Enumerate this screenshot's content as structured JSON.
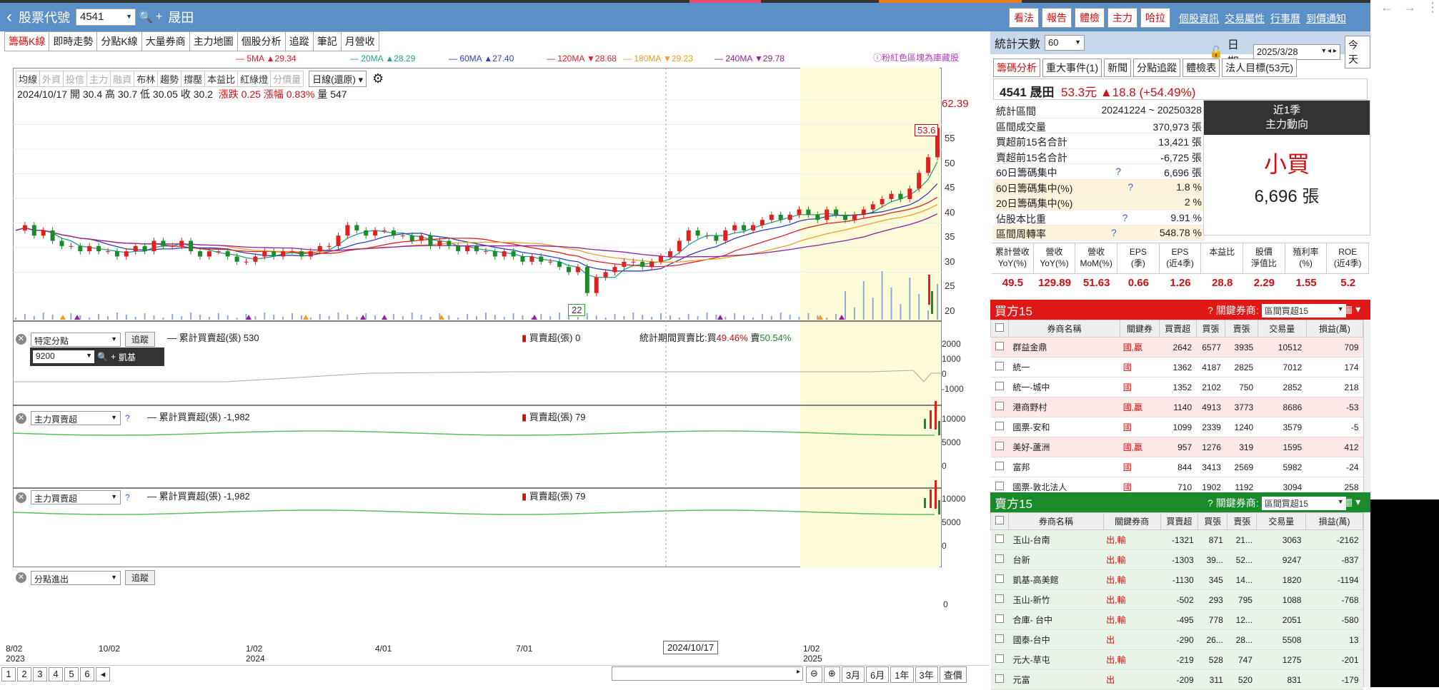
{
  "header": {
    "back": "‹",
    "title": "股票代號",
    "code": "4541",
    "name": "晟田",
    "buttons": [
      "看法",
      "報告",
      "體檢",
      "主力",
      "哈拉"
    ],
    "links": [
      "個股資訊",
      "交易屬性",
      "行事曆",
      "到價通知"
    ]
  },
  "tabs": [
    "籌碼K線",
    "即時走勢",
    "分點K線",
    "大量券商",
    "主力地圖",
    "個股分析",
    "追蹤",
    "筆記",
    "月營收"
  ],
  "ma_legend": [
    {
      "label": "5MA",
      "arrow": "▲",
      "value": "29.34",
      "color": "#e02020"
    },
    {
      "label": "20MA",
      "arrow": "▲",
      "value": "28.29",
      "color": "#20a090"
    },
    {
      "label": "60MA",
      "arrow": "▲",
      "value": "27.40",
      "color": "#3040c0"
    },
    {
      "label": "120MA",
      "arrow": "▼",
      "value": "28.68",
      "color": "#e02020"
    },
    {
      "label": "180MA",
      "arrow": "▼",
      "value": "29.23",
      "color": "#f0a020"
    },
    {
      "label": "240MA",
      "arrow": "▼",
      "value": "29.78",
      "color": "#9020a0"
    }
  ],
  "warning": "粉紅色區塊為庫藏股",
  "tools": [
    "均線",
    "外資",
    "投信",
    "主力",
    "融資",
    "布林",
    "趨勢",
    "撐壓",
    "本益比",
    "紅綠燈",
    "分價量"
  ],
  "tools_dim": [
    false,
    true,
    true,
    true,
    true,
    false,
    false,
    false,
    false,
    false,
    true
  ],
  "period_select": "日線(還原)",
  "ohlc": {
    "date": "2024/10/17",
    "open_l": "開",
    "open": "30.4",
    "high_l": "高",
    "high": "30.7",
    "low_l": "低",
    "low": "30.05",
    "close_l": "收",
    "close": "30.2",
    "chg_l": "漲跌",
    "chg": "0.25",
    "pct_l": "漲幅",
    "pct": "0.83%",
    "vol_l": "量",
    "vol": "547"
  },
  "price_axis": {
    "max_label": "62.39",
    "last": "53.6",
    "low_marker": "22",
    "ticks": [
      "55",
      "50",
      "45",
      "40",
      "35",
      "30",
      "25",
      "20"
    ]
  },
  "chart_data": {
    "type": "candlestick",
    "x_ticks": [
      "8/02\n2023",
      "10/02",
      "1/02\n2024",
      "4/01",
      "7/01",
      "1/02\n2025"
    ],
    "close_series": [
      34,
      35,
      33,
      34,
      32,
      31,
      31,
      30,
      31,
      30,
      30,
      29,
      30,
      31,
      30,
      32,
      31,
      31,
      32,
      30,
      29,
      30,
      30,
      29,
      28,
      28,
      29,
      30,
      29,
      30,
      30,
      29,
      30,
      31,
      31,
      33,
      35,
      34,
      33,
      34,
      34,
      33,
      33,
      32,
      33,
      31,
      32,
      31,
      30,
      31,
      30,
      30,
      29,
      30,
      29,
      28,
      29,
      28,
      28,
      27,
      26,
      27,
      22,
      25,
      26,
      27,
      28,
      28,
      27,
      28,
      29,
      30,
      32,
      34,
      33,
      33,
      32,
      34,
      35,
      34,
      35,
      36,
      37,
      36,
      37,
      38,
      37,
      36,
      38,
      37,
      36,
      37,
      38,
      39,
      40,
      41,
      40,
      42,
      45,
      48,
      53.6
    ],
    "ylim": [
      18,
      62.39
    ]
  },
  "panel1": {
    "select": "特定分點",
    "track": "追蹤",
    "branch": "9200",
    "branch_name": "凱基",
    "cum_label": "累計買賣超(張)",
    "cum": "530",
    "net_label": "買賣超(張)",
    "net": "0",
    "ratio_label": "統計期間買賣比:買",
    "buy_pct": "49.46%",
    "sell_l": "賣",
    "sell_pct": "50.54%",
    "ticks": [
      "2000",
      "1000",
      "0",
      "-1000"
    ]
  },
  "panel2": {
    "select": "主力買賣超",
    "q": "?",
    "cum_label": "累計買賣超(張)",
    "cum": "-1,982",
    "net_label": "買賣超(張)",
    "net": "79",
    "ticks": [
      "10000",
      "5000",
      "0"
    ]
  },
  "panel3": {
    "select": "主力買賣超",
    "q": "?",
    "cum_label": "累計買賣超(張)",
    "cum": "-1,982",
    "net_label": "買賣超(張)",
    "net": "79",
    "ticks": [
      "10000",
      "5000",
      "0"
    ]
  },
  "panel4": {
    "select": "分點進出",
    "track": "追蹤",
    "tick": "0"
  },
  "xaxis": [
    {
      "m": "8/02",
      "y": "2023"
    },
    {
      "m": "10/02",
      "y": ""
    },
    {
      "m": "1/02",
      "y": "2024"
    },
    {
      "m": "4/01",
      "y": ""
    },
    {
      "m": "7/01",
      "y": ""
    },
    {
      "m": "1/02",
      "y": "2025"
    }
  ],
  "crosshair_date": "2024/10/17",
  "pages": [
    "1",
    "2",
    "3",
    "4",
    "5",
    "6"
  ],
  "zoom": [
    "3月",
    "6月",
    "1年",
    "3年",
    "查價"
  ],
  "rp": {
    "days_label": "統計天數",
    "days": "60",
    "date_label": "日期",
    "date": "2025/3/28",
    "today": "今天",
    "tabs": [
      "籌碼分析",
      "重大事件(1)",
      "新聞",
      "分點追蹤",
      "體檢表",
      "法人目標(53元)"
    ],
    "quote": {
      "name": "4541 晟田",
      "price": "53.3元",
      "chg": "▲18.8 (+54.49%)"
    },
    "stats": [
      {
        "k": "統計區間",
        "v": "20241224 ~ 20250328",
        "hl": false,
        "q": ""
      },
      {
        "k": "區間成交量",
        "v": "370,973 張",
        "hl": false,
        "q": ""
      },
      {
        "k": "買超前15名合計",
        "v": "13,421 張",
        "hl": false,
        "q": ""
      },
      {
        "k": "賣超前15名合計",
        "v": "-6,725 張",
        "hl": false,
        "q": ""
      },
      {
        "k": "60日籌碼集中",
        "v": "6,696 張",
        "hl": false,
        "q": "?"
      },
      {
        "k": "60日籌碼集中(%)",
        "v": "1.8 %",
        "hl": true,
        "q": "?"
      },
      {
        "k": "20日籌碼集中(%)",
        "v": "2 %",
        "hl": true,
        "q": ""
      },
      {
        "k": "佔股本比重",
        "v": "9.91 %",
        "hl": false,
        "q": "?"
      },
      {
        "k": "區間周轉率",
        "v": "548.78 %",
        "hl": true,
        "q": "?"
      }
    ],
    "major": {
      "t1": "近1季",
      "t2": "主力動向",
      "big": "小買",
      "num": "6,696 張"
    },
    "fin_head": [
      "累計營收\nYoY(%)",
      "營收\nYoY(%)",
      "營收\nMoM(%)",
      "EPS\n(季)",
      "EPS\n(近4季)",
      "本益比",
      "股價\n淨值比",
      "殖利率\n(%)",
      "ROE\n(近4季)"
    ],
    "fin_vals": [
      "49.5",
      "129.89",
      "51.63",
      "0.66",
      "1.26",
      "28.8",
      "2.29",
      "1.55",
      "5.2"
    ],
    "buy_title": "買方15",
    "sell_title": "賣方15",
    "kw_label": "關鍵券商:",
    "kw_sel": "區間買超15",
    "buy_head": [
      "券商名稱",
      "關鍵券",
      "買賣超",
      "買張",
      "賣張",
      "交易量",
      "損益(萬)"
    ],
    "sell_head": [
      "券商名稱",
      "關鍵券商",
      "買賣超",
      "買張",
      "賣張",
      "交易量",
      "損益(萬)"
    ],
    "buy_rows": [
      {
        "n": "群益金鼎",
        "t": "國,贏",
        "a": "2642",
        "b": "6577",
        "c": "3935",
        "d": "10512",
        "e": "709",
        "p": true
      },
      {
        "n": "統一",
        "t": "國",
        "a": "1362",
        "b": "4187",
        "c": "2825",
        "d": "7012",
        "e": "174",
        "p": false
      },
      {
        "n": "統一-城中",
        "t": "國",
        "a": "1352",
        "b": "2102",
        "c": "750",
        "d": "2852",
        "e": "218",
        "p": false
      },
      {
        "n": "港商野村",
        "t": "國,贏",
        "a": "1140",
        "b": "4913",
        "c": "3773",
        "d": "8686",
        "e": "-53",
        "p": true
      },
      {
        "n": "國票-安和",
        "t": "國",
        "a": "1099",
        "b": "2339",
        "c": "1240",
        "d": "3579",
        "e": "-5",
        "p": false
      },
      {
        "n": "美好-蘆洲",
        "t": "國,贏",
        "a": "957",
        "b": "1276",
        "c": "319",
        "d": "1595",
        "e": "412",
        "p": true
      },
      {
        "n": "富邦",
        "t": "國",
        "a": "844",
        "b": "3413",
        "c": "2569",
        "d": "5982",
        "e": "-24",
        "p": false
      },
      {
        "n": "國票-敦北法人",
        "t": "國",
        "a": "710",
        "b": "1902",
        "c": "1192",
        "d": "3094",
        "e": "258",
        "p": false
      }
    ],
    "sell_rows": [
      {
        "n": "玉山-台南",
        "t": "出,輸",
        "a": "-1321",
        "b": "871",
        "c": "21...",
        "d": "3063",
        "e": "-2162"
      },
      {
        "n": "台新",
        "t": "出,輸",
        "a": "-1303",
        "b": "39...",
        "c": "52...",
        "d": "9247",
        "e": "-837"
      },
      {
        "n": "凱基-高美館",
        "t": "出,輸",
        "a": "-1130",
        "b": "345",
        "c": "14...",
        "d": "1820",
        "e": "-1194"
      },
      {
        "n": "玉山-新竹",
        "t": "出,輸",
        "a": "-502",
        "b": "293",
        "c": "795",
        "d": "1088",
        "e": "-768"
      },
      {
        "n": "合庫- 台中",
        "t": "出,輸",
        "a": "-495",
        "b": "778",
        "c": "12...",
        "d": "2051",
        "e": "-580"
      },
      {
        "n": "國泰-台中",
        "t": "出",
        "a": "-290",
        "b": "26...",
        "c": "28...",
        "d": "5508",
        "e": "13"
      },
      {
        "n": "元大-草屯",
        "t": "出,輸",
        "a": "-219",
        "b": "528",
        "c": "747",
        "d": "1275",
        "e": "-201"
      },
      {
        "n": "元富",
        "t": "出",
        "a": "-209",
        "b": "311",
        "c": "520",
        "d": "831",
        "e": "-179"
      }
    ]
  }
}
